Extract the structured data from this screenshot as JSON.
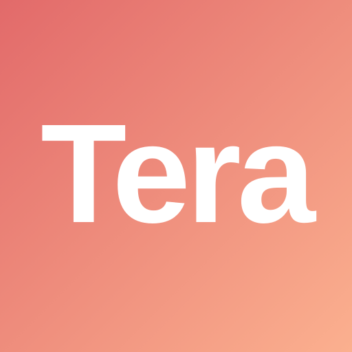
{
  "logo": {
    "text": "Tera"
  },
  "colors": {
    "gradient_start": "#e26a6a",
    "gradient_end": "#fbb08f",
    "text": "#ffffff"
  }
}
